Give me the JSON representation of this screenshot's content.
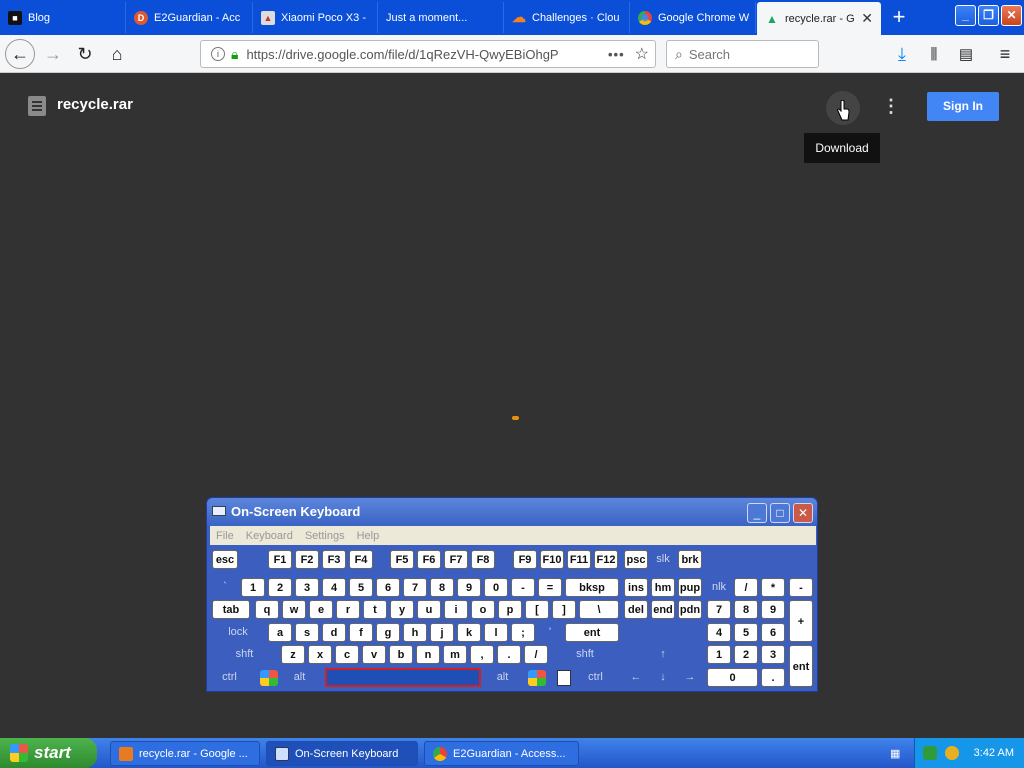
{
  "browser": {
    "tabs": [
      {
        "label": "Blog",
        "fav": "■"
      },
      {
        "label": "E2Guardian - Acc",
        "fav": "D"
      },
      {
        "label": "Xiaomi Poco X3 -",
        "fav": "▲"
      },
      {
        "label": "Just a moment...",
        "fav": ""
      },
      {
        "label": "Challenges · Clou",
        "fav": "☁"
      },
      {
        "label": "Google Chrome W",
        "fav": "◉"
      },
      {
        "label": "recycle.rar - G",
        "fav": "▲"
      }
    ],
    "url": "https://drive.google.com/file/d/1qRezVH-QwyEBiOhgP",
    "search_placeholder": "Search"
  },
  "drive": {
    "filename": "recycle.rar",
    "download_tooltip": "Download",
    "signin_label": "Sign In"
  },
  "osk": {
    "title": "On-Screen Keyboard",
    "menu": [
      "File",
      "Keyboard",
      "Settings",
      "Help"
    ]
  },
  "taskbar": {
    "start_label": "start",
    "items": [
      {
        "label": "recycle.rar - Google ..."
      },
      {
        "label": "On-Screen Keyboard"
      },
      {
        "label": "E2Guardian - Access..."
      }
    ],
    "clock": "3:42 AM"
  }
}
